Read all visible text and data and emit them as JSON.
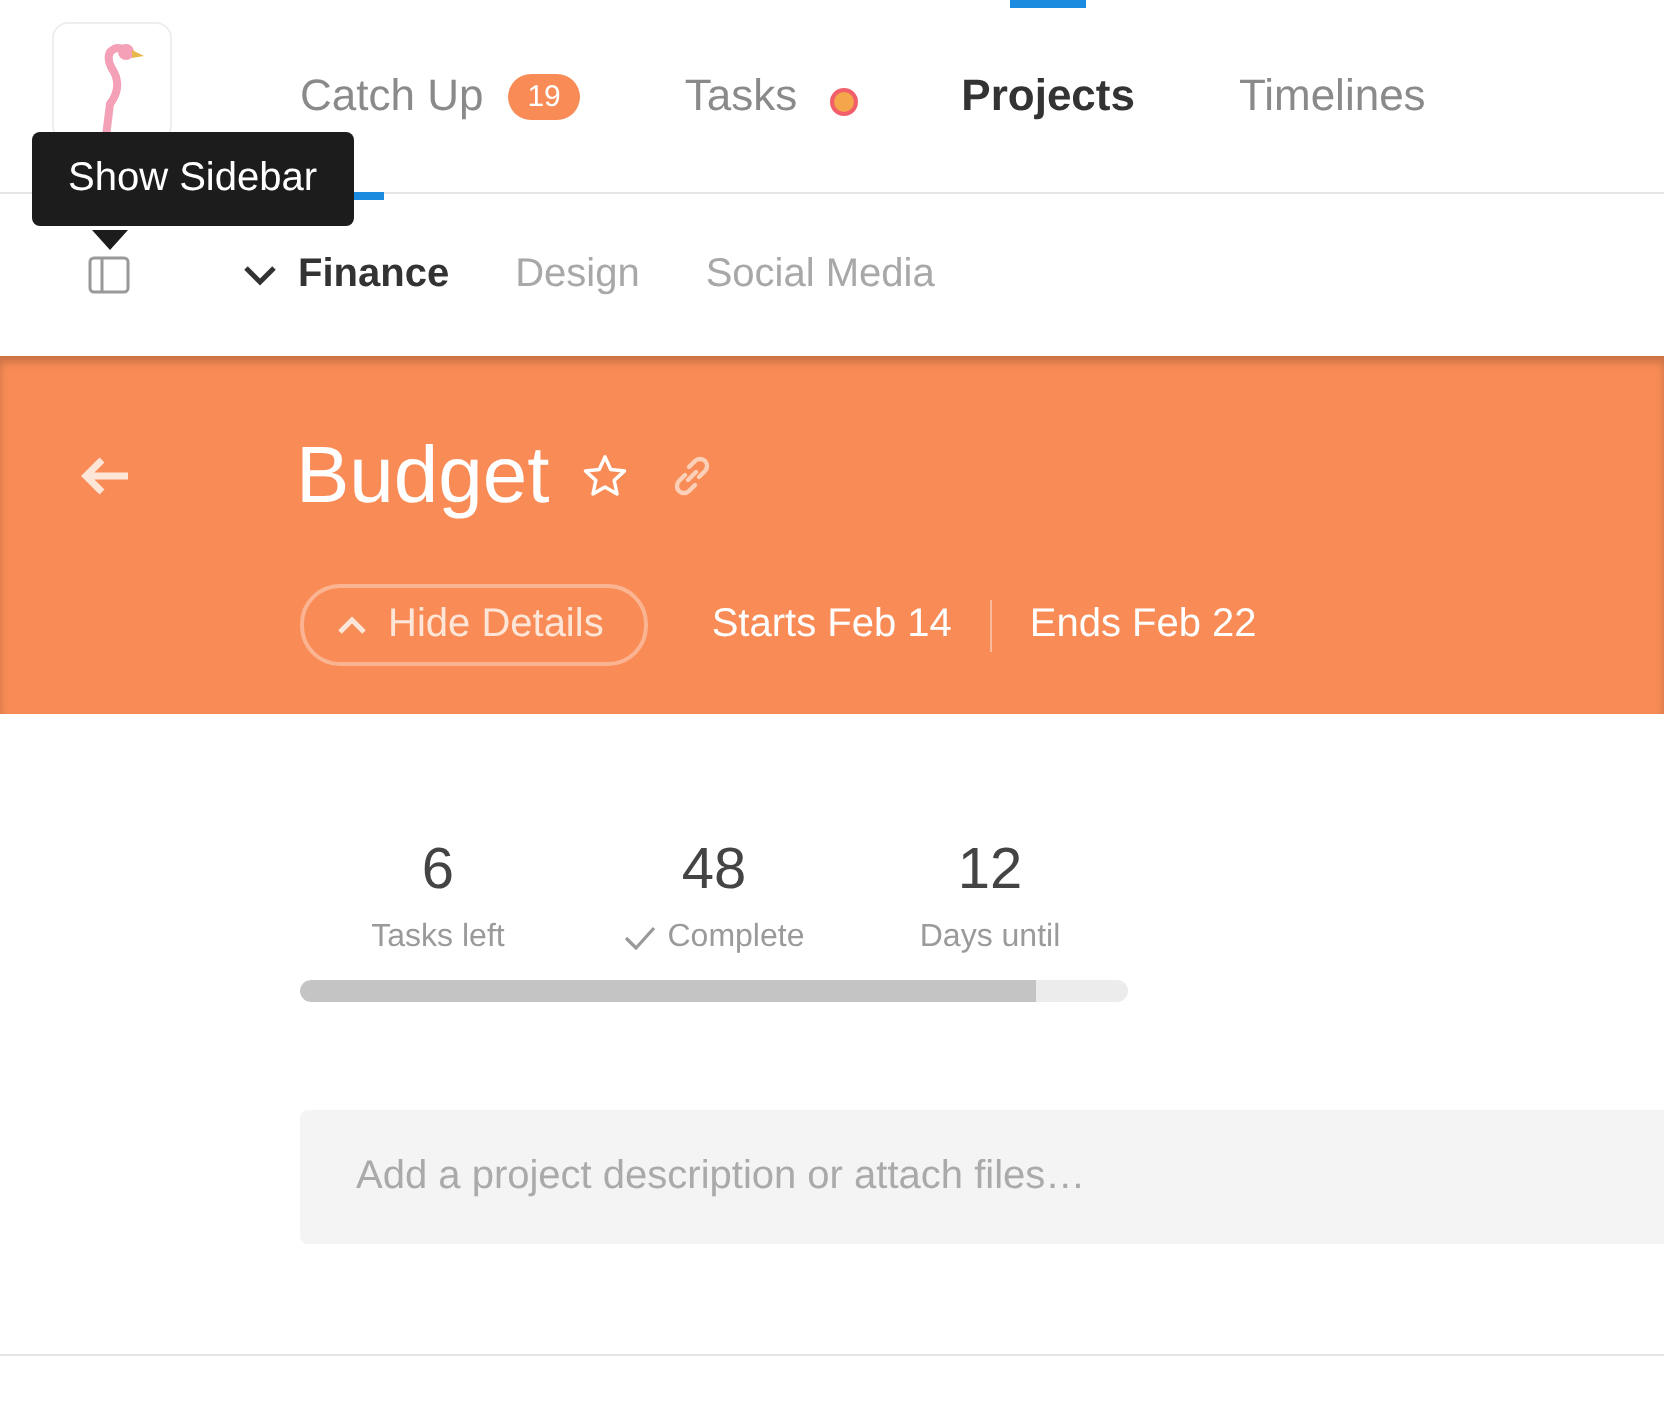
{
  "tooltip": {
    "text": "Show Sidebar"
  },
  "tabs": [
    {
      "label": "Catch Up",
      "badge": "19",
      "selected": false,
      "underlined": true,
      "dot": false
    },
    {
      "label": "Tasks",
      "selected": false,
      "underlined": false,
      "dot": true
    },
    {
      "label": "Projects",
      "selected": true,
      "underlined": false,
      "dot": false
    },
    {
      "label": "Timelines",
      "selected": false,
      "underlined": false,
      "dot": false
    }
  ],
  "project_tabs": [
    {
      "label": "Finance",
      "selected": true
    },
    {
      "label": "Design",
      "selected": false
    },
    {
      "label": "Social Media",
      "selected": false
    }
  ],
  "project": {
    "title": "Budget",
    "starred": false,
    "details_button": "Hide Details",
    "starts": "Starts Feb 14",
    "ends": "Ends Feb 22"
  },
  "stats": [
    {
      "value": "6",
      "label": "Tasks left",
      "check": false
    },
    {
      "value": "48",
      "label": "Complete",
      "check": true
    },
    {
      "value": "12",
      "label": "Days until",
      "check": false
    }
  ],
  "progress": {
    "level": 0.89
  },
  "description": {
    "placeholder": "Add a project description or attach files…"
  }
}
